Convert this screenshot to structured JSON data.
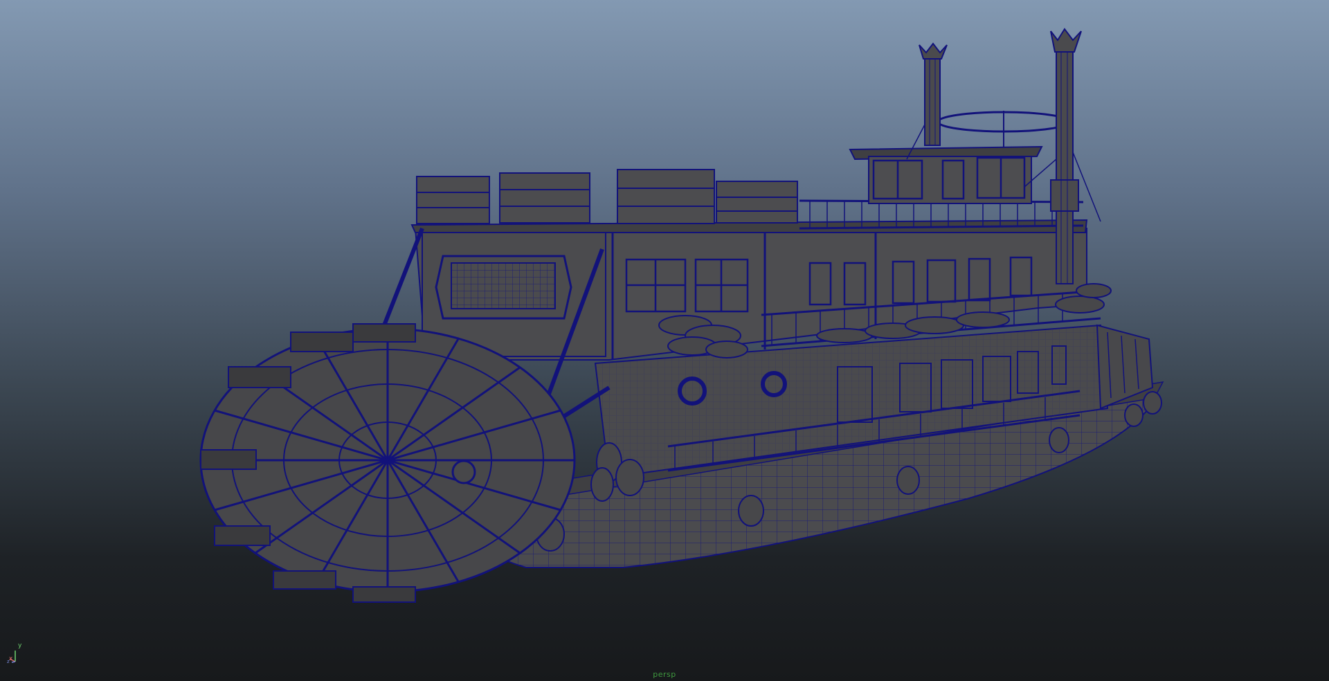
{
  "viewport": {
    "camera": "persp",
    "background_top": "#8399b2",
    "background_bottom": "#17191b",
    "wireframe_color": "#12127a",
    "shaded_color": "#4a4a4c"
  },
  "axis_gizmo": {
    "y_label": "y",
    "x_label": "x",
    "z_label": "z",
    "x_color": "#d96a6a",
    "y_color": "#6fd36f",
    "z_color": "#7a8ce0"
  },
  "scene": {
    "object": "paddle-steamer-model"
  }
}
